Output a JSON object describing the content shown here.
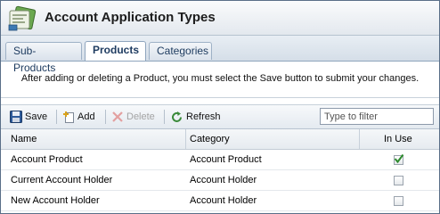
{
  "window": {
    "title": "Account Application Types"
  },
  "tabs": [
    {
      "label": "Sub-Products",
      "active": false
    },
    {
      "label": "Products",
      "active": true
    },
    {
      "label": "Categories",
      "active": false
    }
  ],
  "info_message": "After adding or deleting a Product, you must select the Save button to submit your changes.",
  "toolbar": {
    "save_label": "Save",
    "add_label": "Add",
    "delete_label": "Delete",
    "refresh_label": "Refresh",
    "filter_placeholder": "Type to filter"
  },
  "grid": {
    "columns": [
      "Name",
      "Category",
      "In Use"
    ],
    "rows": [
      {
        "name": "Account Product",
        "category": "Account Product",
        "in_use": true
      },
      {
        "name": "Current Account Holder",
        "category": "Account Holder",
        "in_use": false
      },
      {
        "name": "New Account Holder",
        "category": "Account Holder",
        "in_use": false
      }
    ]
  },
  "colors": {
    "accent": "#1f3c61",
    "border": "#5a6f88",
    "check": "#2e8b2e"
  }
}
